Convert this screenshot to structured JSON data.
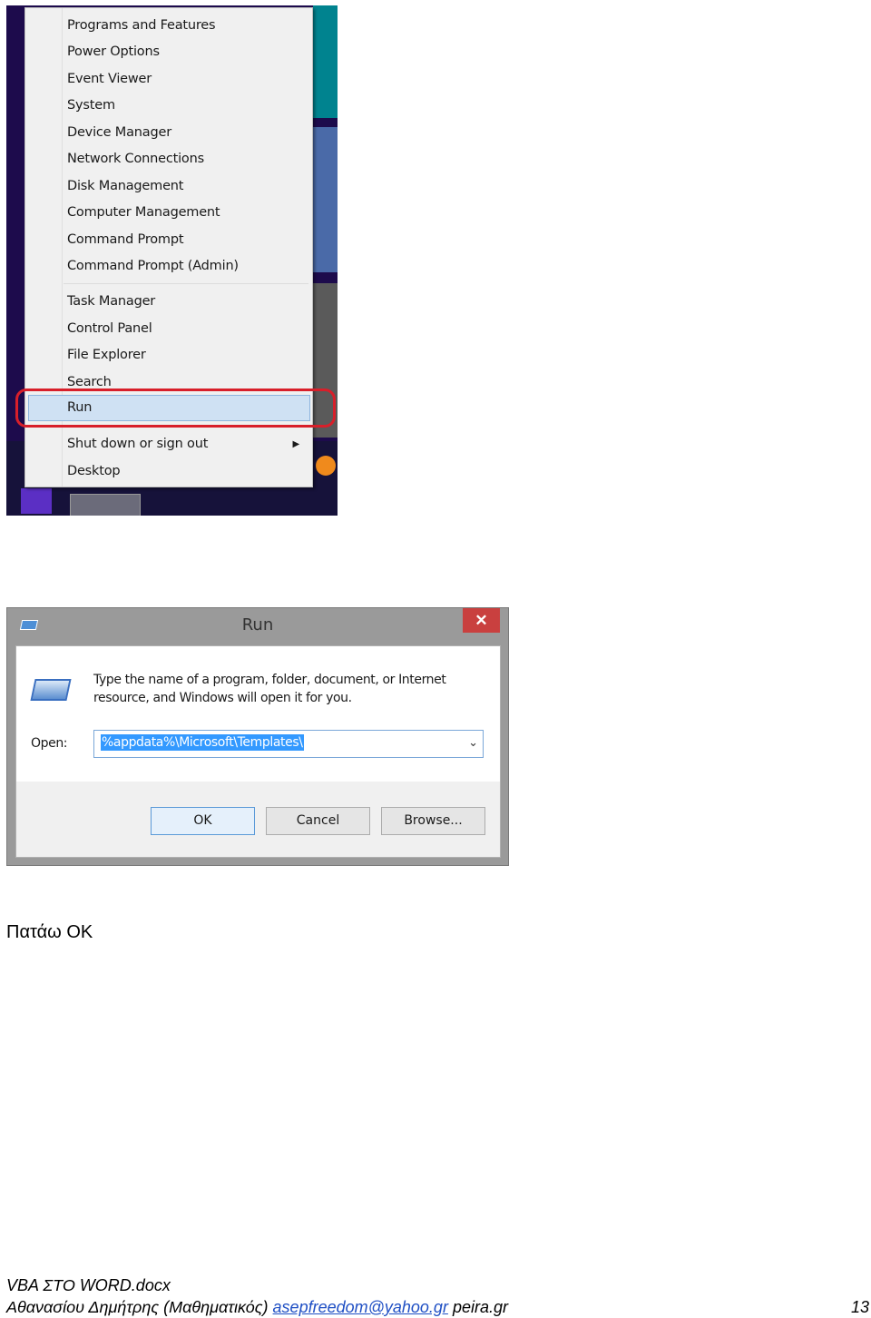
{
  "context_menu": {
    "items_group1": [
      "Programs and Features",
      "Power Options",
      "Event Viewer",
      "System",
      "Device Manager",
      "Network Connections",
      "Disk Management",
      "Computer Management",
      "Command Prompt",
      "Command Prompt (Admin)"
    ],
    "items_group2": [
      "Task Manager",
      "Control Panel",
      "File Explorer",
      "Search",
      "Run"
    ],
    "items_group3": [
      "Shut down or sign out",
      "Desktop"
    ],
    "highlighted": "Run",
    "highlight_color": "#d81f2a"
  },
  "run_dialog": {
    "title": "Run",
    "close": "✕",
    "description_line1": "Type the name of a program, folder, document, or Internet",
    "description_line2": "resource, and Windows will open it for you.",
    "open_label": "Open:",
    "open_value": "%appdata%\\Microsoft\\Templates\\",
    "buttons": {
      "ok": "OK",
      "cancel": "Cancel",
      "browse": "Browse..."
    }
  },
  "caption": "Πατάω ΟΚ",
  "footer": {
    "filename": "VBA ΣΤΟ WORD.docx",
    "author": "Αθανασίου Δημήτρης (Μαθηματικός)",
    "email": "asepfreedom@yahoo.gr",
    "site": "peira.gr",
    "page_number": "13"
  }
}
